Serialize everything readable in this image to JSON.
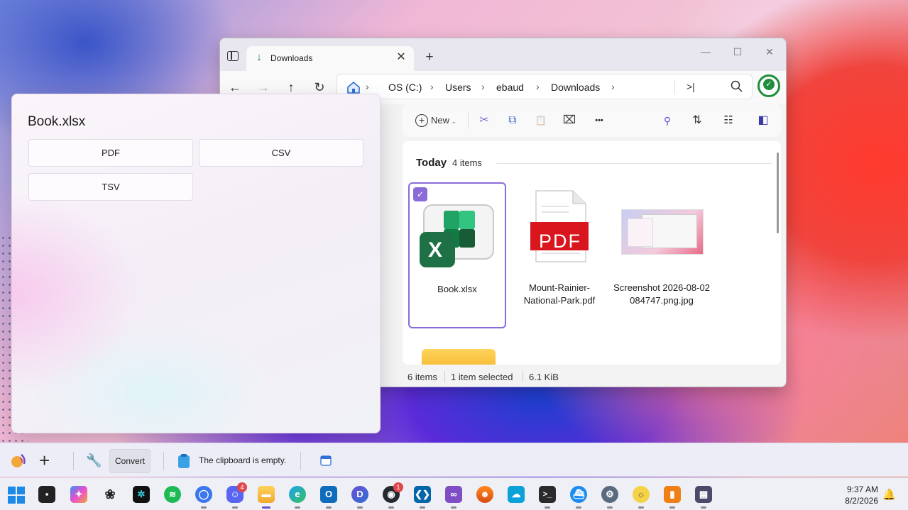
{
  "explorer": {
    "tab_label": "Downloads",
    "tab_close": "✕",
    "tab_add": "+",
    "window": {
      "minimize": "—",
      "maximize": "☐",
      "close": "✕"
    },
    "nav": {
      "back": "←",
      "forward": "→",
      "up": "↑",
      "refresh": "↻"
    },
    "breadcrumb": [
      "OS (C:)",
      "Users",
      "ebaud",
      "Downloads"
    ],
    "breadcrumb_sep": "›",
    "toolbar": {
      "new_label": "New",
      "cut": "✂",
      "copy": "⧉",
      "paste": "📋",
      "rename": "⌧",
      "more": "•••",
      "sort": "⇅",
      "view": "☷",
      "details": "◧"
    },
    "group": {
      "title": "Today",
      "count": "4 items"
    },
    "files": [
      {
        "name": "Book.xlsx",
        "icon": "excel-icon",
        "selected": true
      },
      {
        "name": "Mount-Rainier-National-Park.pdf",
        "icon": "pdf-icon",
        "selected": false
      },
      {
        "name": "Screenshot 2026-08-02 084747.png.jpg",
        "icon": "image-thumbnail",
        "selected": false
      }
    ],
    "pdf_badge_text": "PDF",
    "excel_letter": "X",
    "checkbox_mark": "✓",
    "status": {
      "items": "6 items",
      "selected": "1 item selected",
      "size": "6.1 KiB"
    }
  },
  "flyout": {
    "title": "Book.xlsx",
    "buttons": [
      "PDF",
      "CSV",
      "TSV"
    ]
  },
  "dock": {
    "convert_label": "Convert",
    "clipboard_text": "The clipboard is empty."
  },
  "taskbar": {
    "discord_badge": "4",
    "github_badge": "1",
    "time": "9:37 AM",
    "date": "8/2/2026"
  },
  "colors": {
    "accent": "#8a6bd8",
    "excel_green": "#1e7145",
    "pdf_red": "#d9161d",
    "sync_green": "#1e8e3e"
  }
}
